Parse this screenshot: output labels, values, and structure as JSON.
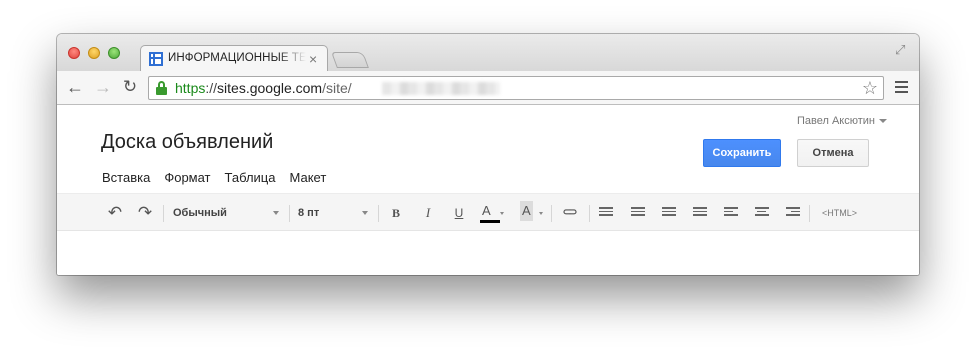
{
  "browser": {
    "tab": {
      "title": "ИНФОРМАЦИОННЫЕ ТЕХНОЛОГИИ",
      "favicon": "sites-page-icon",
      "close_glyph": "×"
    },
    "url": {
      "scheme": "https",
      "separator": "://",
      "host": "sites.google.com",
      "path": "/site/"
    },
    "icons": {
      "back": "←",
      "forward": "→",
      "reload": "↻",
      "star": "☆",
      "fullscreen": "⤢"
    }
  },
  "page": {
    "user_name": "Павел Аксютин",
    "title": "Доска объявлений",
    "save_label": "Сохранить",
    "cancel_label": "Отмена",
    "menu": [
      "Вставка",
      "Формат",
      "Таблица",
      "Макет"
    ]
  },
  "editor_toolbar": {
    "undo_glyph": "↶",
    "redo_glyph": "↷",
    "style_value": "Обычный",
    "size_value": "8 пт",
    "bold_glyph": "B",
    "italic_glyph": "I",
    "underline_glyph": "U",
    "text_color_glyph": "A",
    "highlight_glyph": "A",
    "link_glyph": "⊂⊃",
    "html_label": "<HTML>"
  },
  "colors": {
    "save_button": "#4d90fe",
    "url_scheme": "#1a8a1a",
    "lock": "#3a9a2f"
  }
}
